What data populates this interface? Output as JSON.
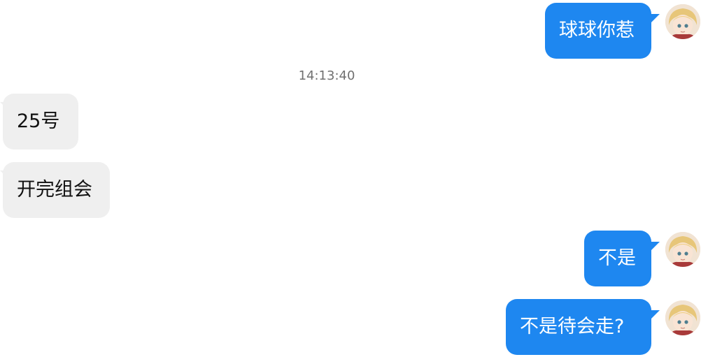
{
  "timestamp": "14:13:40",
  "messages": [
    {
      "side": "out",
      "text": "球球你惹"
    },
    {
      "side": "in",
      "text": "25号"
    },
    {
      "side": "in",
      "text": "开完组会"
    },
    {
      "side": "out",
      "text": "不是"
    },
    {
      "side": "out",
      "text": "不是待会走?"
    }
  ],
  "colors": {
    "outgoing_bubble": "#1e87f0",
    "incoming_bubble": "#efefef",
    "timestamp_text": "#707070"
  },
  "icons": {
    "avatar": "anime-girl-avatar-icon"
  }
}
